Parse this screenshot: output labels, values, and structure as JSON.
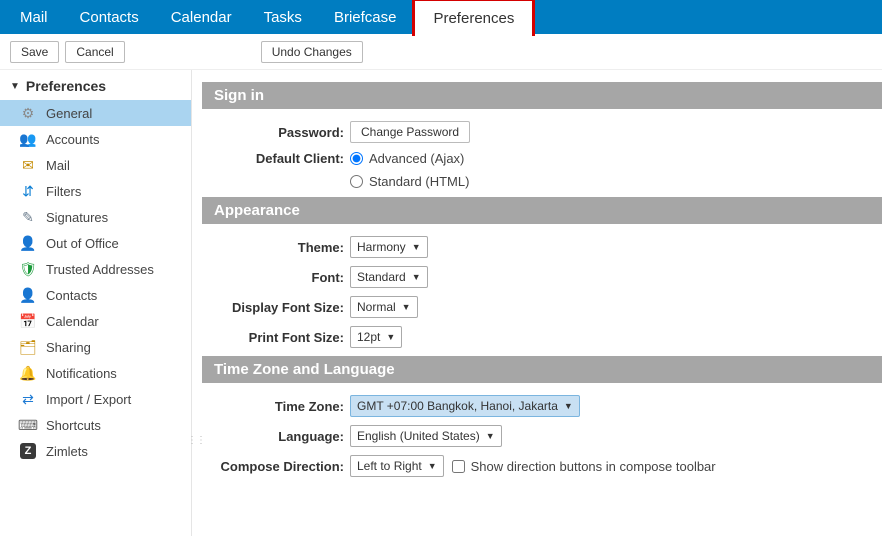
{
  "topnav": {
    "tabs": [
      {
        "label": "Mail"
      },
      {
        "label": "Contacts"
      },
      {
        "label": "Calendar"
      },
      {
        "label": "Tasks"
      },
      {
        "label": "Briefcase"
      },
      {
        "label": "Preferences",
        "active": true
      }
    ]
  },
  "toolbar": {
    "save": "Save",
    "cancel": "Cancel",
    "undo": "Undo Changes"
  },
  "sidebar": {
    "header": "Preferences",
    "items": [
      {
        "label": "General",
        "selected": true,
        "icon": "gear"
      },
      {
        "label": "Accounts",
        "icon": "accounts"
      },
      {
        "label": "Mail",
        "icon": "mail"
      },
      {
        "label": "Filters",
        "icon": "filters"
      },
      {
        "label": "Signatures",
        "icon": "signatures"
      },
      {
        "label": "Out of Office",
        "icon": "ooo"
      },
      {
        "label": "Trusted Addresses",
        "icon": "shield"
      },
      {
        "label": "Contacts",
        "icon": "contacts"
      },
      {
        "label": "Calendar",
        "icon": "calendar"
      },
      {
        "label": "Sharing",
        "icon": "sharing"
      },
      {
        "label": "Notifications",
        "icon": "bell"
      },
      {
        "label": "Import / Export",
        "icon": "importexport"
      },
      {
        "label": "Shortcuts",
        "icon": "shortcuts"
      },
      {
        "label": "Zimlets",
        "icon": "zimlets"
      }
    ]
  },
  "sections": {
    "signin": {
      "title": "Sign in",
      "password_label": "Password:",
      "change_password_btn": "Change Password",
      "default_client_label": "Default Client:",
      "advanced": "Advanced (Ajax)",
      "standard": "Standard (HTML)"
    },
    "appearance": {
      "title": "Appearance",
      "theme_label": "Theme:",
      "theme_value": "Harmony",
      "font_label": "Font:",
      "font_value": "Standard",
      "display_font_label": "Display Font Size:",
      "display_font_value": "Normal",
      "print_font_label": "Print Font Size:",
      "print_font_value": "12pt"
    },
    "timezone": {
      "title": "Time Zone and Language",
      "tz_label": "Time Zone:",
      "tz_value": "GMT +07:00 Bangkok, Hanoi, Jakarta",
      "lang_label": "Language:",
      "lang_value": "English (United States)",
      "compose_label": "Compose Direction:",
      "compose_value": "Left to Right",
      "compose_check": "Show direction buttons in compose toolbar"
    }
  },
  "icons": {
    "gear": "⚙",
    "accounts": "👥",
    "mail": "✉",
    "filters": "⇵",
    "signatures": "✎",
    "ooo": "👤",
    "shield": "🛡",
    "contacts": "👤",
    "calendar": "📅",
    "sharing": "🗂",
    "bell": "🔔",
    "importexport": "⇄",
    "shortcuts": "⌨",
    "zimlets": "Z"
  },
  "icon_colors": {
    "gear": "#8a8a8a",
    "accounts": "#5b5b5b",
    "mail": "#c48a00",
    "filters": "#0d7fd4",
    "signatures": "#6b7c8c",
    "ooo": "#1f7bd4",
    "shield": "#1a9a3a",
    "contacts": "#1f7bd4",
    "calendar": "#1f7bd4",
    "sharing": "#c48a00",
    "bell": "#c48a00",
    "importexport": "#1f7bd4",
    "shortcuts": "#6b6b6b",
    "zimlets": "#3a3a3a"
  }
}
